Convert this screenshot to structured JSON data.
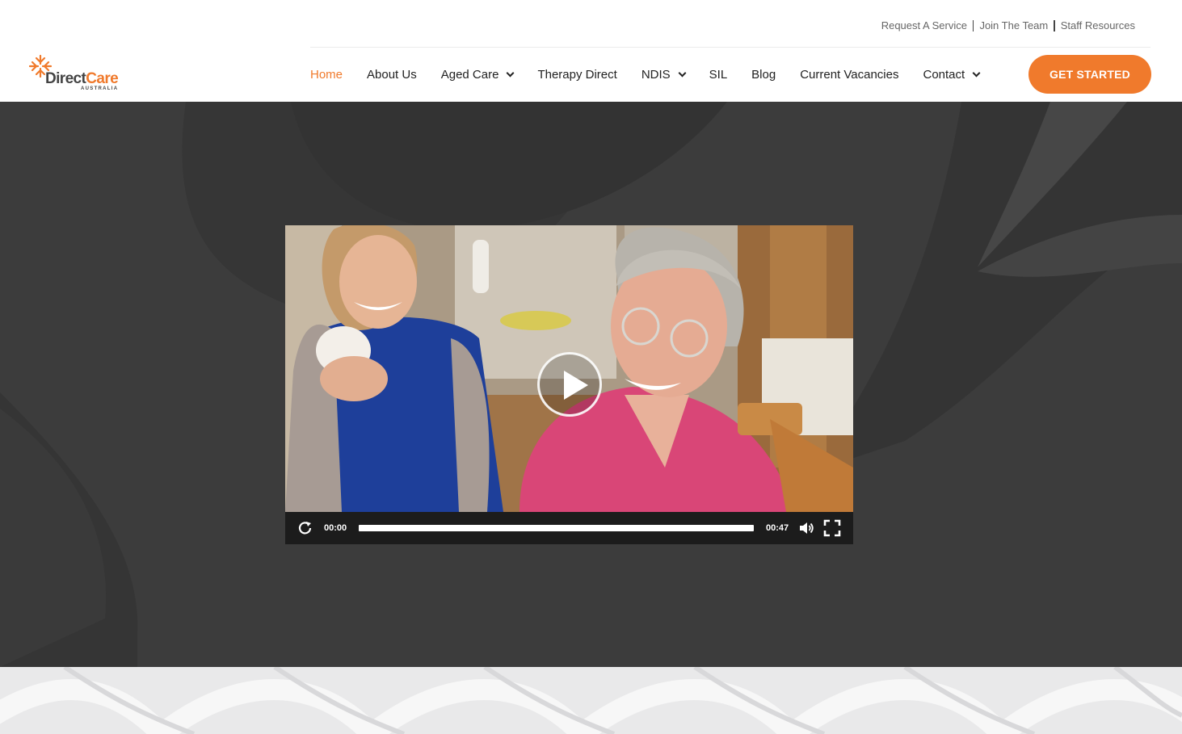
{
  "brand": {
    "name_part1": "Direct",
    "name_part2": "Care",
    "tagline": "AUSTRALIA",
    "accent_color": "#f07a2c"
  },
  "utility_nav": {
    "items": [
      "Request A Service",
      "Join The Team",
      "Staff Resources"
    ]
  },
  "main_nav": {
    "items": [
      {
        "label": "Home",
        "active": true,
        "dropdown": false
      },
      {
        "label": "About Us",
        "active": false,
        "dropdown": false
      },
      {
        "label": "Aged Care",
        "active": false,
        "dropdown": true
      },
      {
        "label": "Therapy Direct",
        "active": false,
        "dropdown": false
      },
      {
        "label": "NDIS",
        "active": false,
        "dropdown": true
      },
      {
        "label": "SIL",
        "active": false,
        "dropdown": false
      },
      {
        "label": "Blog",
        "active": false,
        "dropdown": false
      },
      {
        "label": "Current Vacancies",
        "active": false,
        "dropdown": false
      },
      {
        "label": "Contact",
        "active": false,
        "dropdown": true
      }
    ],
    "cta_label": "GET STARTED"
  },
  "video": {
    "current_time": "00:00",
    "duration": "00:47",
    "progress": 0,
    "icons": [
      "replay-icon",
      "play-icon",
      "volume-icon",
      "fullscreen-icon"
    ]
  }
}
